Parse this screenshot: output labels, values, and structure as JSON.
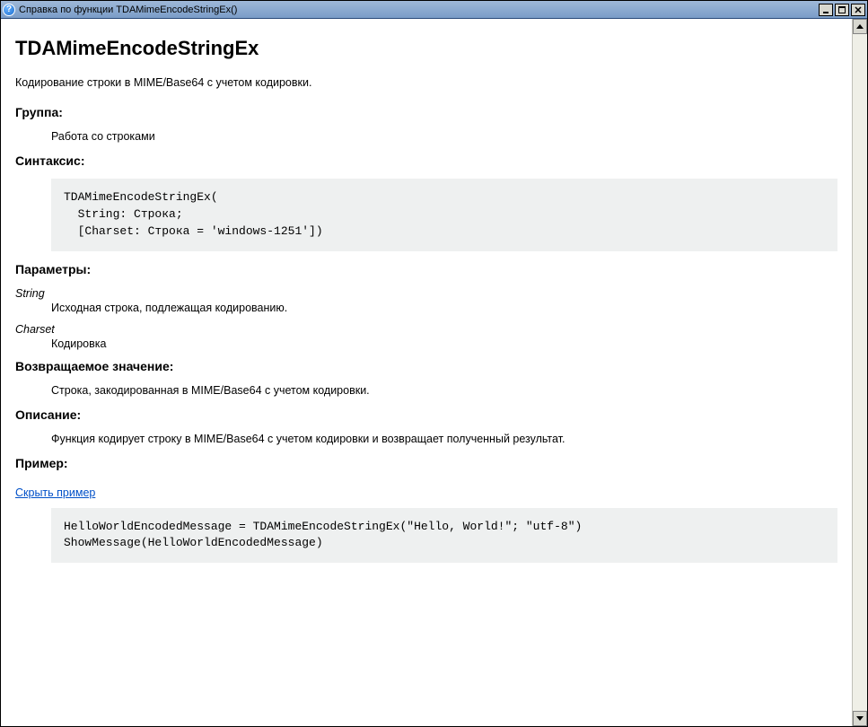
{
  "window": {
    "title": "Справка по функции TDAMimeEncodeStringEx()"
  },
  "page": {
    "title": "TDAMimeEncodeStringEx",
    "summary": "Кодирование строки в MIME/Base64 с учетом кодировки."
  },
  "sections": {
    "group_heading": "Группа:",
    "group_value": "Работа со строками",
    "syntax_heading": "Синтаксис:",
    "syntax_code": "TDAMimeEncodeStringEx(\n  String: Строка;\n  [Charset: Строка = 'windows-1251'])",
    "params_heading": "Параметры:",
    "params": [
      {
        "name": "String",
        "desc": "Исходная строка, подлежащая кодированию."
      },
      {
        "name": "Charset",
        "desc": "Кодировка"
      }
    ],
    "return_heading": "Возвращаемое значение:",
    "return_value": "Строка, закодированная в MIME/Base64 с учетом кодировки.",
    "desc_heading": "Описание:",
    "desc_value": "Функция кодирует строку в MIME/Base64 с учетом кодировки и возвращает полученный результат.",
    "example_heading": "Пример:",
    "example_toggle": "Скрыть пример",
    "example_code": "HelloWorldEncodedMessage = TDAMimeEncodeStringEx(\"Hello, World!\"; \"utf-8\")\nShowMessage(HelloWorldEncodedMessage)"
  }
}
